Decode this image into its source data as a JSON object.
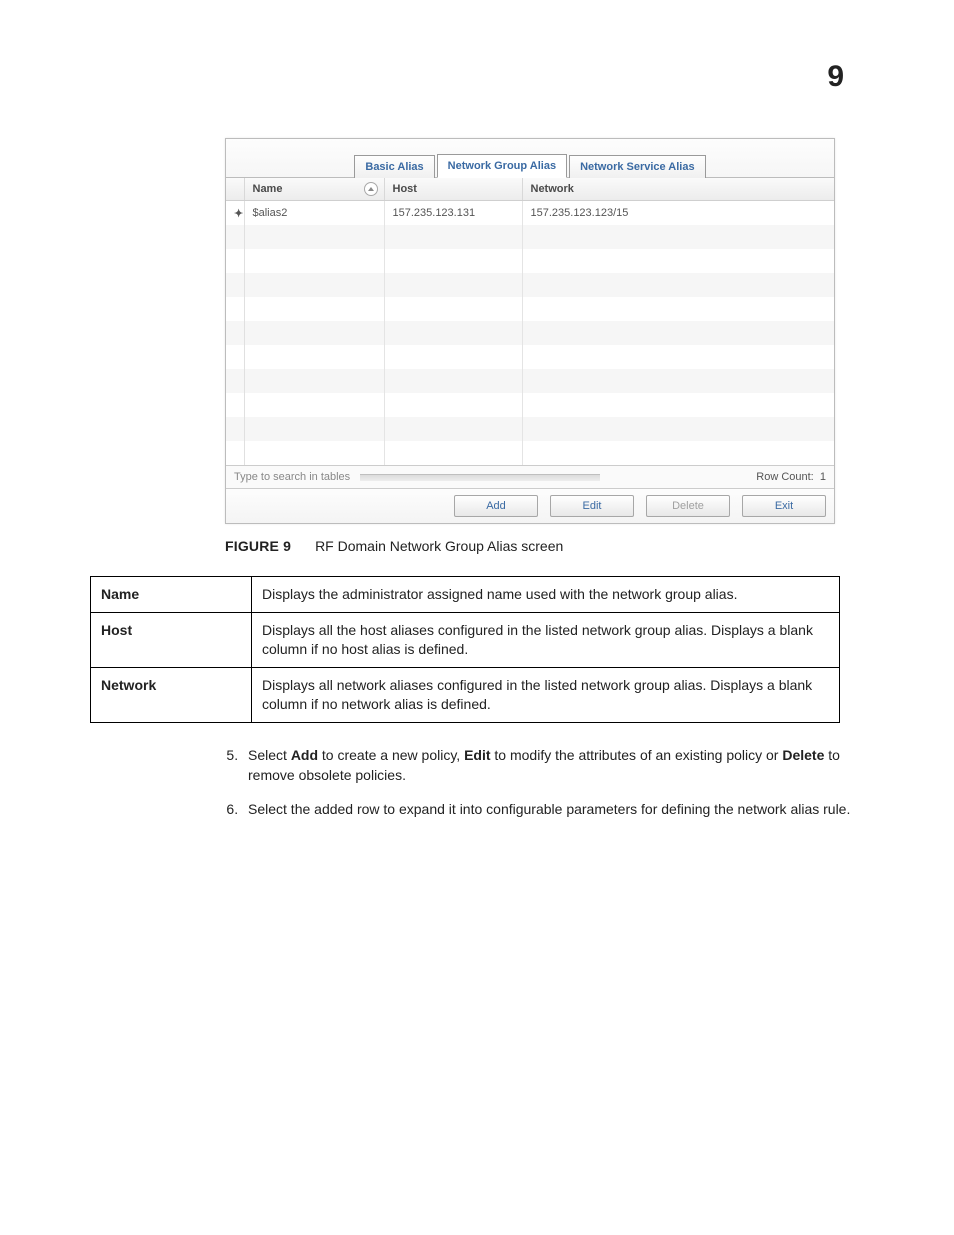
{
  "page_number": "9",
  "tabs": {
    "basic": "Basic Alias",
    "group": "Network Group Alias",
    "service": "Network Service Alias"
  },
  "grid_headers": {
    "name": "Name",
    "host": "Host",
    "network": "Network"
  },
  "grid_rows": [
    {
      "name": "$alias2",
      "host": "157.235.123.131",
      "network": "157.235.123.123/15"
    }
  ],
  "search": {
    "placeholder": "Type to search in tables",
    "row_count_label": "Row Count:",
    "row_count_value": "1"
  },
  "buttons": {
    "add": "Add",
    "edit": "Edit",
    "delete": "Delete",
    "exit": "Exit"
  },
  "figure": {
    "label": "FIGURE 9",
    "title": "RF Domain Network Group Alias screen"
  },
  "desc_table": [
    {
      "k": "Name",
      "v": "Displays the administrator assigned name used with the network group alias."
    },
    {
      "k": "Host",
      "v": "Displays all the host aliases configured in the listed network group alias. Displays a blank column if no host alias is defined."
    },
    {
      "k": "Network",
      "v": "Displays all network aliases configured in the listed network group alias. Displays a blank column if no network alias is defined."
    }
  ],
  "steps": {
    "s5_a": "Select ",
    "s5_add": "Add",
    "s5_b": " to create a new policy, ",
    "s5_edit": "Edit",
    "s5_c": " to modify the attributes of an existing policy or ",
    "s5_delete": "Delete",
    "s5_d": " to remove obsolete policies.",
    "s6": "Select the added row to expand it into configurable parameters for defining the network alias rule."
  }
}
